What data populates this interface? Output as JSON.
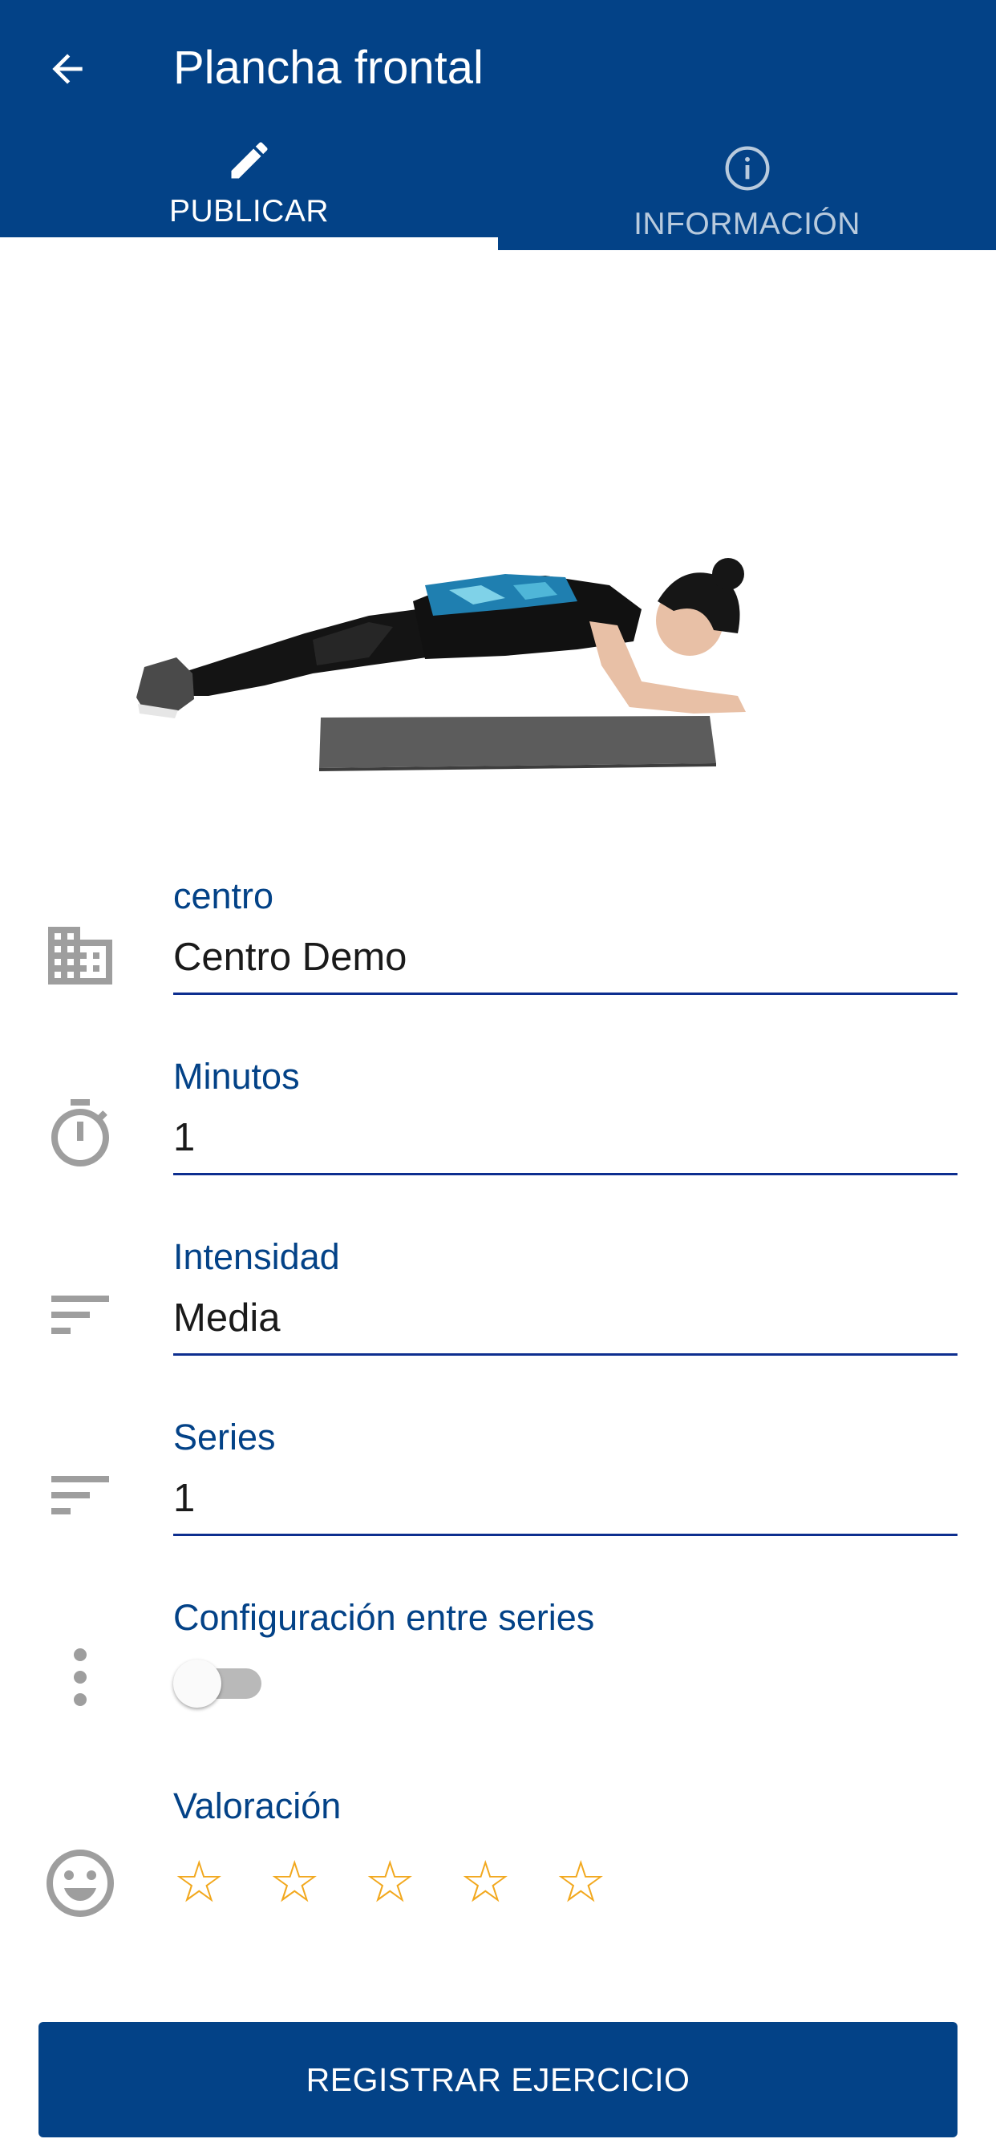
{
  "header": {
    "title": "Plancha frontal",
    "back_icon": "arrow-left-icon"
  },
  "tabs": [
    {
      "label": "PUBLICAR",
      "icon": "pencil-icon",
      "active": true
    },
    {
      "label": "INFORMACIÓN",
      "icon": "info-icon",
      "active": false
    }
  ],
  "form": {
    "centro": {
      "label": "centro",
      "value": "Centro Demo",
      "icon": "building-icon"
    },
    "minutos": {
      "label": "Minutos",
      "value": "1",
      "icon": "stopwatch-icon"
    },
    "intensidad": {
      "label": "Intensidad",
      "value": "Media",
      "icon": "sort-icon"
    },
    "series": {
      "label": "Series",
      "value": "1",
      "icon": "sort-icon"
    },
    "config_series": {
      "label": "Configuración entre series",
      "enabled": false,
      "icon": "more-vertical-icon"
    },
    "valoracion": {
      "label": "Valoración",
      "rating": 0,
      "max": 5,
      "icon": "smiley-icon"
    }
  },
  "submit_label": "REGISTRAR EJERCICIO",
  "colors": {
    "primary": "#034287",
    "star": "#f2a81d",
    "icon_gray": "#9e9e9e"
  }
}
